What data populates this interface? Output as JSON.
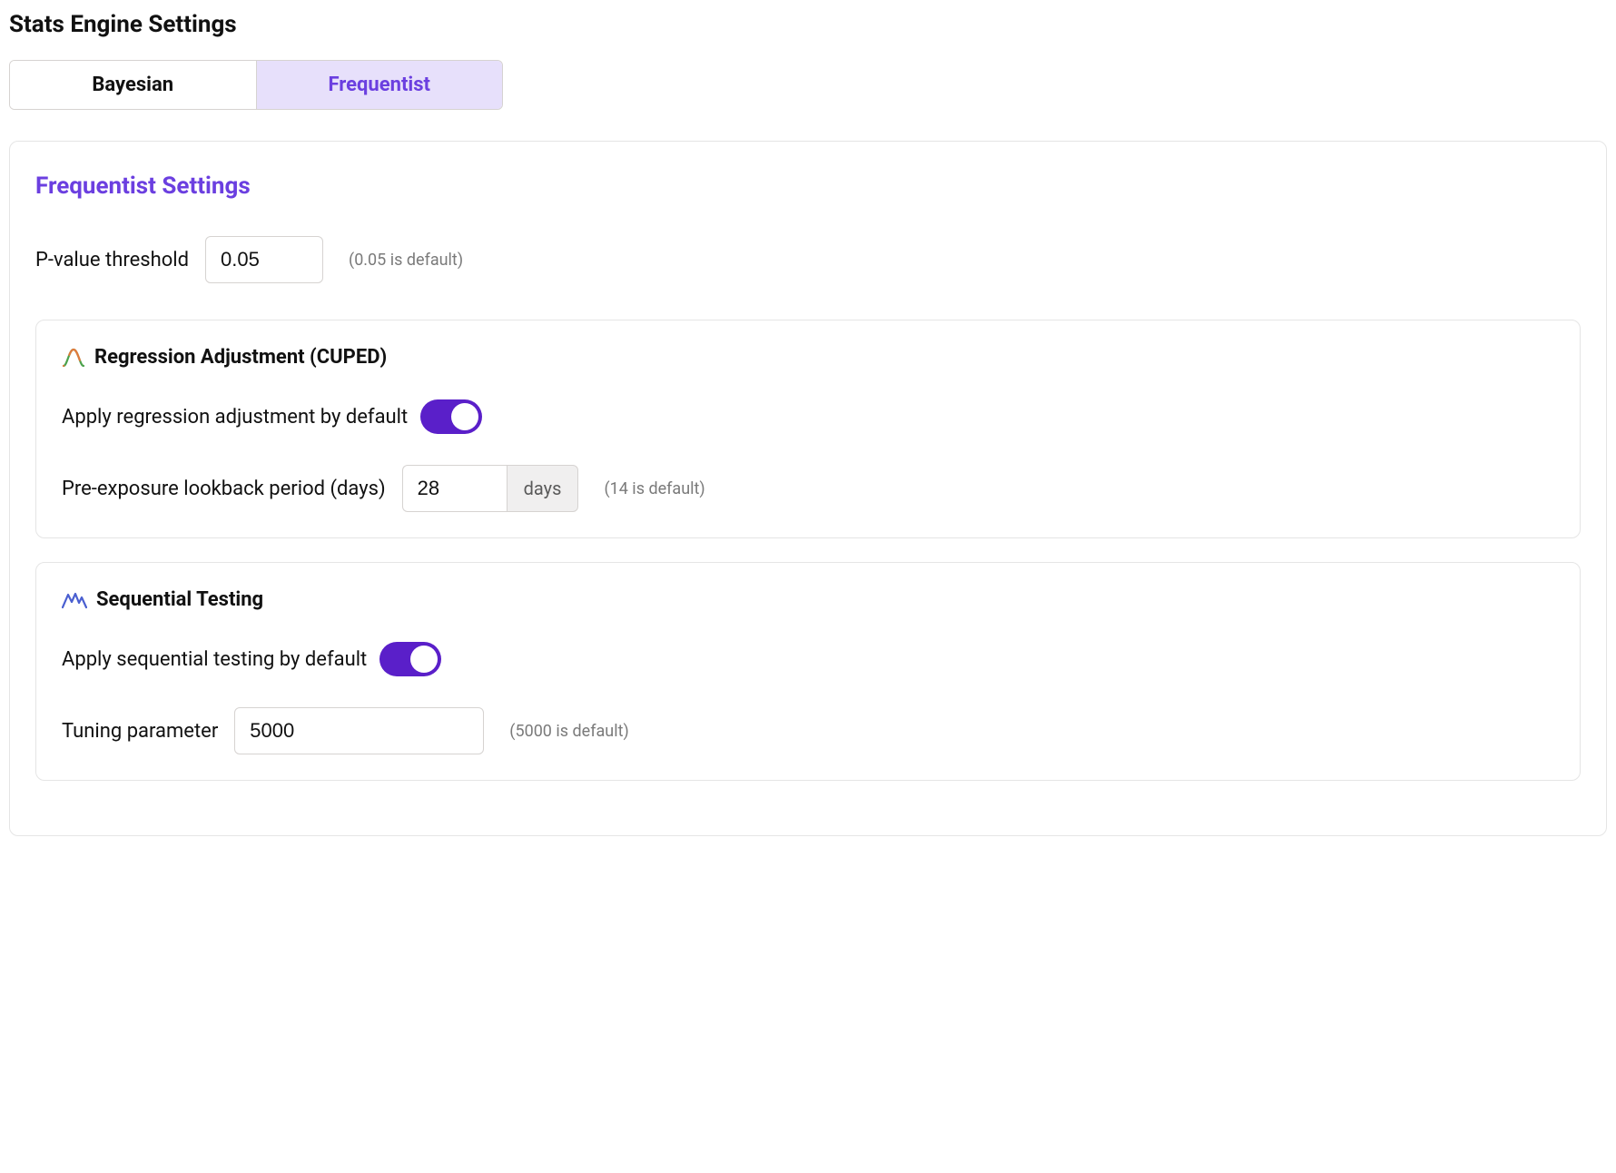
{
  "page_title": "Stats Engine Settings",
  "tabs": {
    "bayesian": "Bayesian",
    "frequentist": "Frequentist"
  },
  "panel": {
    "title": "Frequentist Settings",
    "pvalue": {
      "label": "P-value threshold",
      "value": "0.05",
      "hint": "(0.05 is default)"
    },
    "regression": {
      "title": "Regression Adjustment (CUPED)",
      "toggle_label": "Apply regression adjustment by default",
      "lookback_label": "Pre-exposure lookback period (days)",
      "lookback_value": "28",
      "lookback_unit": "days",
      "lookback_hint": "(14 is default)"
    },
    "sequential": {
      "title": "Sequential Testing",
      "toggle_label": "Apply sequential testing by default",
      "tuning_label": "Tuning parameter",
      "tuning_value": "5000",
      "tuning_hint": "(5000 is default)"
    }
  }
}
